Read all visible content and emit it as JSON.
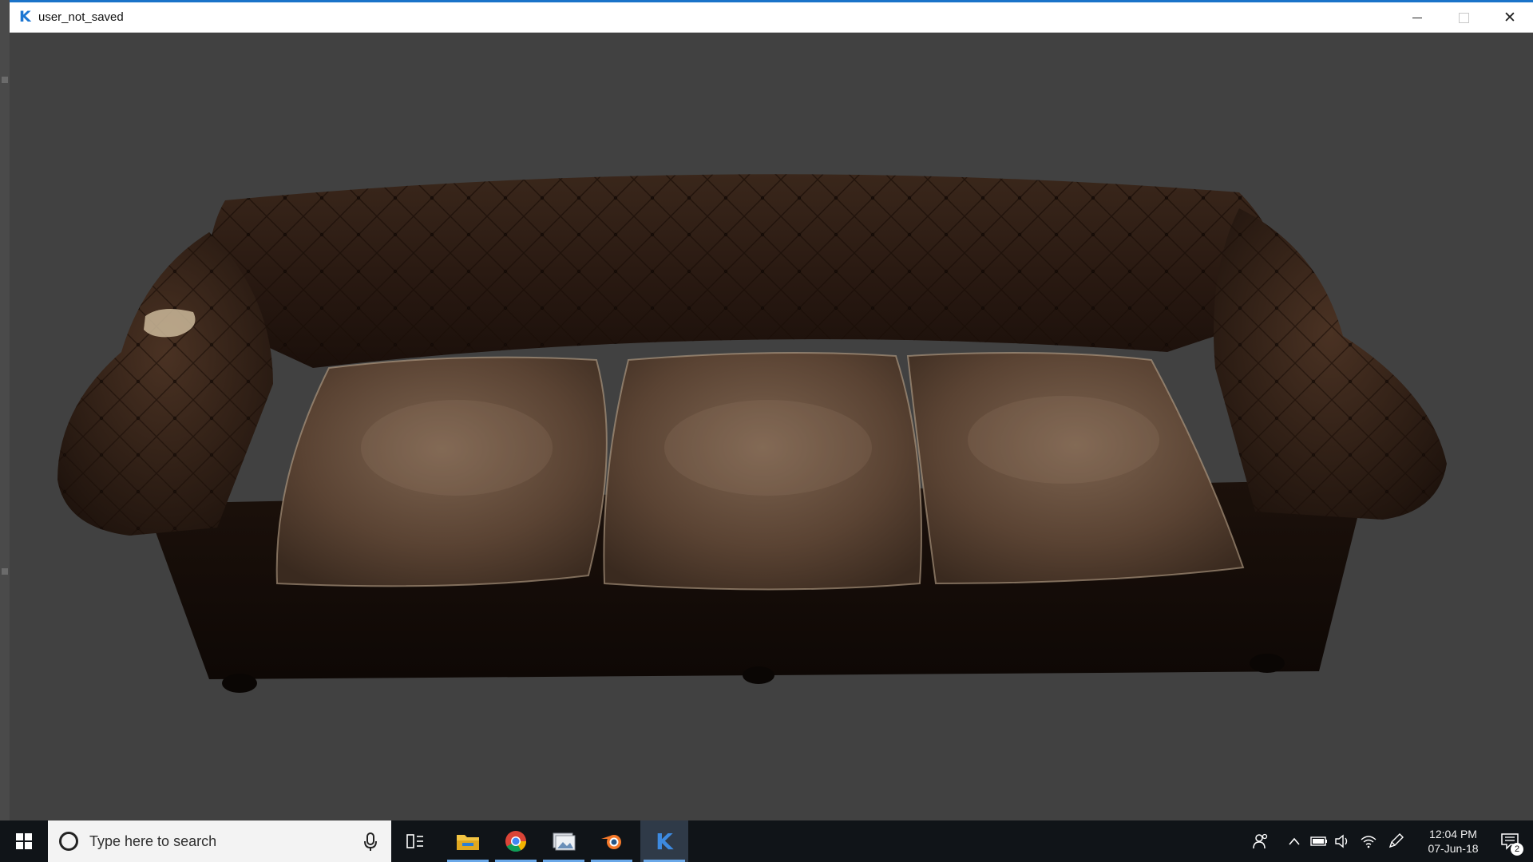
{
  "window": {
    "title": "user_not_saved",
    "app_icon_glyph": "K",
    "controls": [
      "minimize",
      "maximize",
      "close"
    ]
  },
  "viewport": {
    "content": "3d-model-chesterfield-sofa",
    "background_color": "#414141"
  },
  "taskbar": {
    "search_placeholder": "Type here to search",
    "pinned_apps": [
      {
        "name": "task-view",
        "icon": "task-view-icon"
      },
      {
        "name": "file-explorer",
        "icon": "folder-icon"
      },
      {
        "name": "chrome",
        "icon": "chrome-icon"
      },
      {
        "name": "image-viewer",
        "icon": "image-app-icon"
      },
      {
        "name": "blender",
        "icon": "blender-icon"
      },
      {
        "name": "k-app",
        "icon": "k-app-icon",
        "active": true
      }
    ],
    "tray": {
      "time": "12:04 PM",
      "date": "07-Jun-18",
      "notification_count": "2"
    }
  },
  "colors": {
    "accent": "#1b76d2",
    "taskbar_bg": "#101418",
    "underline": "#6aa8e8"
  }
}
